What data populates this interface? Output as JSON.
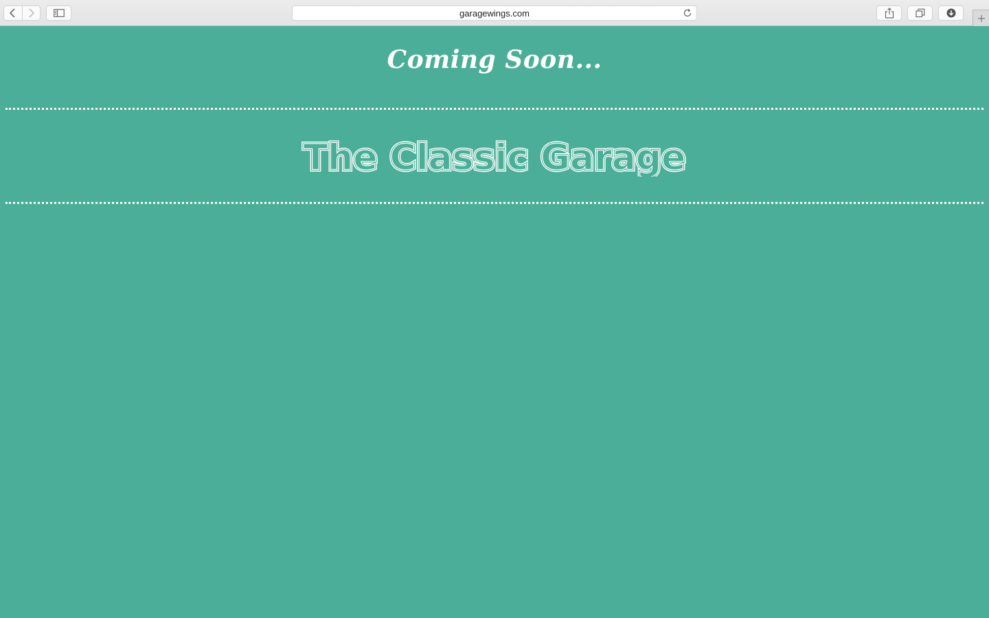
{
  "browser": {
    "url": "garagewings.com"
  },
  "page": {
    "tagline": "Coming Soon...",
    "logo_text": "The Classic Garage"
  },
  "colors": {
    "background": "#4bae98",
    "foreground": "#ffffff"
  }
}
